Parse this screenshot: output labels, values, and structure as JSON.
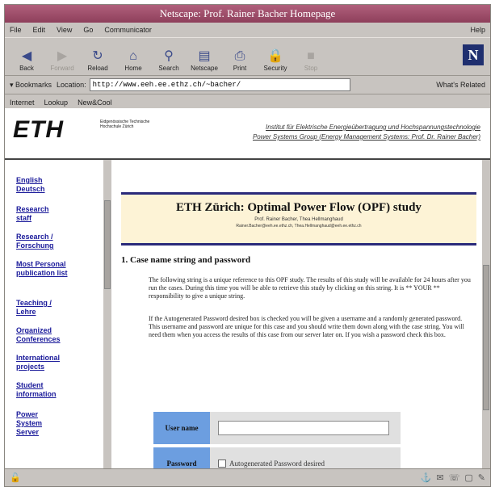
{
  "window": {
    "title": "Netscape: Prof. Rainer Bacher Homepage"
  },
  "menu": {
    "items": [
      "File",
      "Edit",
      "View",
      "Go",
      "Communicator"
    ],
    "help": "Help"
  },
  "toolbar": {
    "buttons": [
      {
        "label": "Back",
        "icon": "back-arrow-icon",
        "enabled": true
      },
      {
        "label": "Forward",
        "icon": "forward-arrow-icon",
        "enabled": false
      },
      {
        "label": "Reload",
        "icon": "reload-icon",
        "enabled": true
      },
      {
        "label": "Home",
        "icon": "home-icon",
        "enabled": true
      },
      {
        "label": "Search",
        "icon": "search-icon",
        "enabled": true
      },
      {
        "label": "Netscape",
        "icon": "netscape-guide-icon",
        "enabled": true
      },
      {
        "label": "Print",
        "icon": "print-icon",
        "enabled": true
      },
      {
        "label": "Security",
        "icon": "security-lock-icon",
        "enabled": true
      },
      {
        "label": "Stop",
        "icon": "stop-icon",
        "enabled": false
      }
    ],
    "logo": "N"
  },
  "location": {
    "bookmarks_label": "Bookmarks",
    "location_label": "Location:",
    "url": "http://www.eeh.ee.ethz.ch/~bacher/",
    "related_label": "What's Related"
  },
  "personal_toolbar": {
    "items": [
      "Internet",
      "Lookup",
      "New&Cool"
    ]
  },
  "page": {
    "logo": "ETH",
    "logo_sub": "Eidgenössische Technische Hochschule Zürich",
    "institute_line1": "Institut für Elektrische Energieübertragung und Hochspannungstechnologie",
    "institute_line2": "Power Systems Group (Energy Management Systems: Prof. Dr. Rainer Bacher)",
    "nav": [
      "English Deutsch",
      "Research staff",
      "Research / Forschung",
      "Most Personal publication list",
      "Teaching / Lehre",
      "Organized Conferences",
      "International projects",
      "Student information",
      "Power System Server"
    ],
    "study_title": "ETH Zürich: Optimal Power Flow (OPF) study",
    "authors": "Prof. Rainer Bacher, Thea Hellmanghaud",
    "emails": "Rainer.Bacher@eeh.ee.ethz.ch, Thea.Hellmanghaud@eeh.ee.ethz.ch",
    "section_heading": "1. Case name string and password",
    "para1": "The following string is a unique reference to this OPF study. The results of this study will be available for 24 hours after you run the cases. During this time you will be able to retrieve this study by clicking on this string. It is ** YOUR ** responsibility to give a unique string.",
    "para2": "If the Autogenerated Password desired box is checked you will be given a username and a randomly generated password. This username and password are unique for this case and you should write them down along with the case string. You will need them when you access the results of this case from our server later on. If you wish a password check this box.",
    "form": {
      "username_label": "User name",
      "username_value": "",
      "password_label": "Password",
      "autogen_label": "Autogenerated Password desired"
    }
  }
}
